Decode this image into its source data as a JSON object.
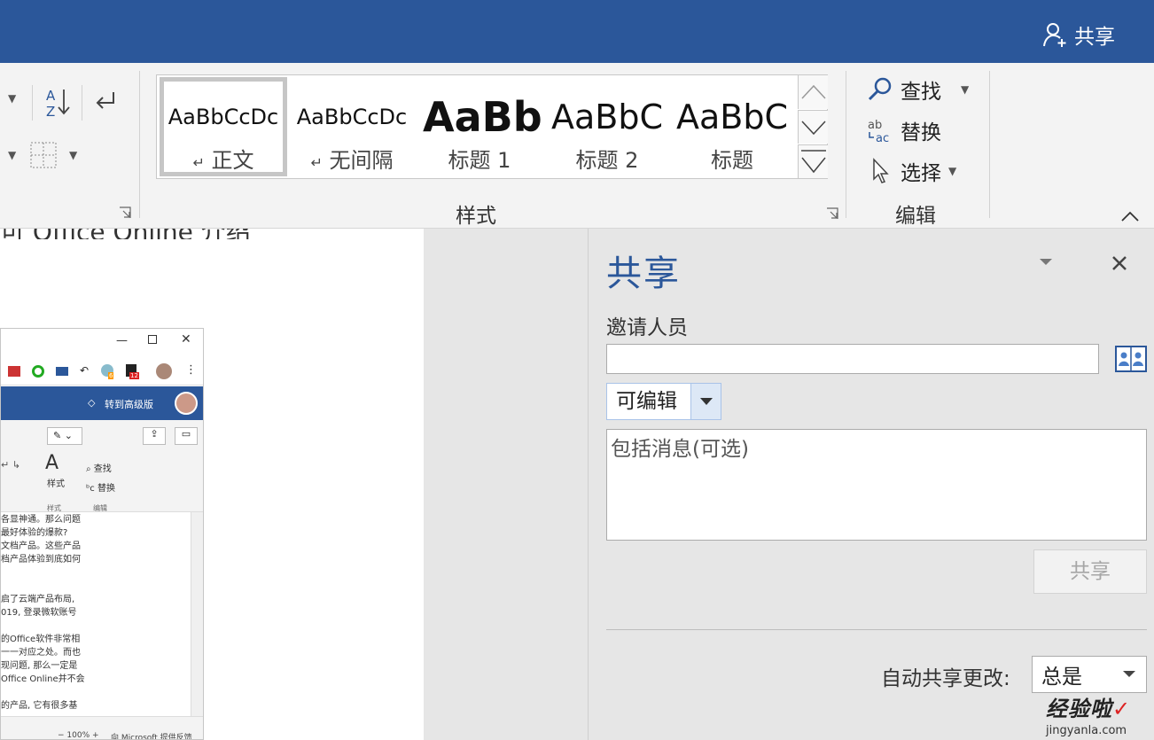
{
  "titlebar": {
    "share_label": "共享"
  },
  "ribbon": {
    "styles_group_label": "样式",
    "editing_group_label": "编辑",
    "styles": [
      {
        "sample": "AaBbCcDc",
        "name": "正文",
        "mark": "↵"
      },
      {
        "sample": "AaBbCcDc",
        "name": "无间隔",
        "mark": "↵"
      },
      {
        "sample": "AaBb",
        "name": "标题 1",
        "mark": ""
      },
      {
        "sample": "AaBbC",
        "name": "标题 2",
        "mark": ""
      },
      {
        "sample": "AaBbC",
        "name": "标题",
        "mark": ""
      }
    ],
    "find_label": "查找",
    "replace_label": "替换",
    "select_label": "选择",
    "sort_label": "A↓Z"
  },
  "document": {
    "partial_line": "可 Office Online 介绍"
  },
  "mini_window": {
    "upgrade_label": "转到高级版",
    "style_label": "样式",
    "find_label": "查找",
    "replace_label": "替换",
    "group_styles": "样式",
    "group_edit": "编辑",
    "badge_count": "12",
    "badge_small": "6",
    "text_lines": [
      "各显神通。那么问题",
      "最好体验的爆款?",
      "文档产品。这些产品",
      "档产品体验到底如何",
      "",
      "",
      "启了云端产品布局,",
      "019, 登录微软账号",
      "",
      "的Office软件非常相",
      "一一对应之处。而也",
      "现问题, 那么一定是",
      "Office Online并不会",
      "",
      "的产品, 它有很多基"
    ],
    "zoom_label": "100%",
    "feedback_label": "向 Microsoft 提供反馈"
  },
  "share_pane": {
    "title": "共享",
    "invite_label": "邀请人员",
    "invite_value": "",
    "permission": "可编辑",
    "message_placeholder": "包括消息(可选)",
    "share_button": "共享",
    "auto_share_label": "自动共享更改:",
    "auto_share_value": "总是"
  },
  "watermark": {
    "text": "经验啦",
    "url": "jingyanla.com"
  }
}
